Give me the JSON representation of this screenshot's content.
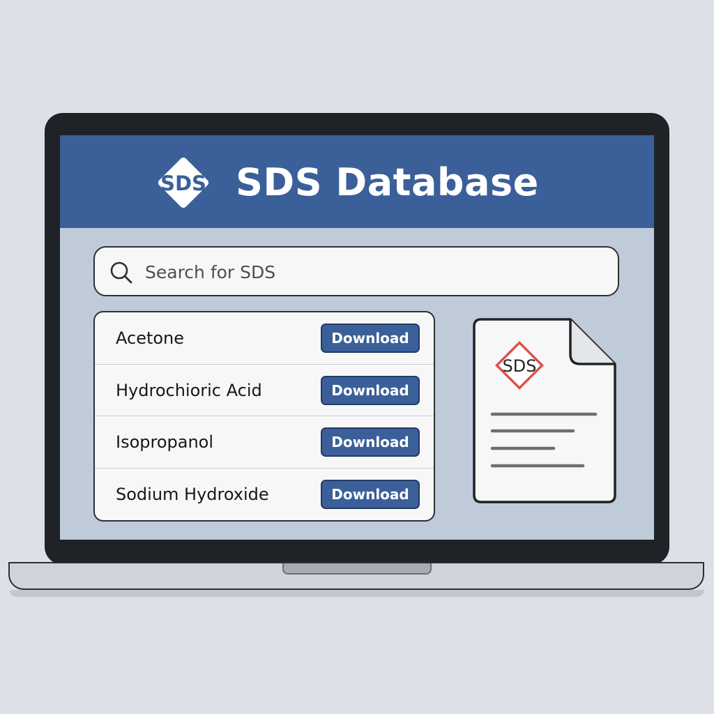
{
  "app": {
    "title": "SDS Database",
    "logo_text": "SDS",
    "logo_icon": "sds-diamond-logo"
  },
  "search": {
    "placeholder": "Search for SDS",
    "value": "",
    "icon": "search-icon"
  },
  "sds_list": {
    "items": [
      {
        "name": "Acetone",
        "action_label": "Download"
      },
      {
        "name": "Hydrochioric Acid",
        "action_label": "Download"
      },
      {
        "name": "Isopropanol",
        "action_label": "Download"
      },
      {
        "name": "Sodium Hydroxide",
        "action_label": "Download"
      }
    ]
  },
  "document": {
    "icon": "document-icon",
    "label": "SDS"
  },
  "colors": {
    "header": "#3b5f99",
    "screen_background": "#bfcbd9",
    "button": "#3b5f99",
    "hazard_diamond": "#d9534f"
  }
}
